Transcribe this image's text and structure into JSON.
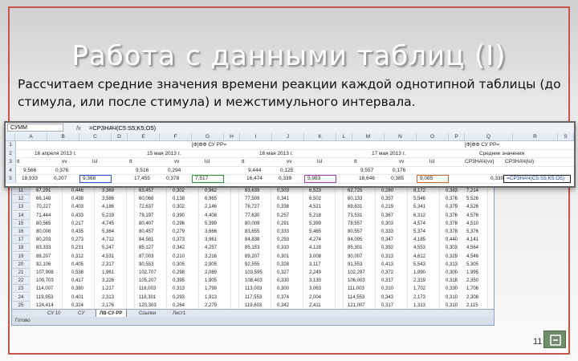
{
  "slide": {
    "title": "Работа с данными таблиц (I)",
    "paragraph": "Рассчитаем средние значения времени реакции каждой однотипной таблицы (до стимула, или после стимула) и межстимульного интервала.",
    "page_number": "11"
  },
  "formula_bar": {
    "name_box": "СУММ",
    "fx": "fx",
    "formula": "=СРЗНАЧ(C5:S5;K5;O5)"
  },
  "overlay": {
    "columns": [
      "A",
      "B",
      "C",
      "D",
      "E",
      "F",
      "G",
      "H",
      "I",
      "J",
      "K",
      "L",
      "M",
      "N",
      "O",
      "P",
      "Q",
      "R",
      "S"
    ],
    "row1": {
      "num": "1",
      "left": "[Ф]ФФ СУ РР=",
      "right": "[Ф]ФФ СУ РР="
    },
    "row2": {
      "num": "2",
      "dates": [
        "16 апреля 2013 г.",
        "15 мая 2013 г.",
        "16 мая 2013 г.",
        "17 мая 2013 г."
      ],
      "avg_title": "Средние значения"
    },
    "row3": {
      "num": "3",
      "labels": [
        "tt",
        "vv",
        "lsl",
        "tt",
        "vv",
        "lsl",
        "tt",
        "vv",
        "lsl",
        "tt",
        "vv",
        "lsl"
      ],
      "avg_label": "СРЗНАЧ(vv)",
      "avg_label2": "СРЗНАЧ(lsl)"
    },
    "row4": {
      "num": "4",
      "values": [
        "9,566",
        "0,376",
        "9,516",
        "0,294",
        "9,444",
        "0,125",
        "9,557",
        "0,176"
      ]
    },
    "row5": {
      "num": "5",
      "values": [
        "18,933",
        "0,207",
        "9,368",
        "17,455",
        "0,378",
        "7,517",
        "16,474",
        "0,339",
        "5,983",
        "18,646",
        "0,385",
        "9,085",
        "0,330"
      ],
      "formula_echo": "=СРЗНАЧ(C5:S5;K5:O5)"
    }
  },
  "sheet": {
    "rows": [
      {
        "n": "11",
        "v": [
          "67,291",
          "0,446",
          "3,369",
          "63,457",
          "0,302",
          "0,962",
          "83,639",
          "0,303",
          "6,523",
          "62,725",
          "0,280",
          "8,172",
          "0,383",
          "7,214"
        ]
      },
      {
        "n": "12",
        "v": [
          "66,148",
          "0,438",
          "3,586",
          "60,068",
          "0,138",
          "6,965",
          "77,509",
          "0,341",
          "6,502",
          "60,133",
          "0,357",
          "5,546",
          "0,376",
          "5,526"
        ]
      },
      {
        "n": "13",
        "v": [
          "70,227",
          "0,403",
          "4,186",
          "72,637",
          "0,302",
          "2,146",
          "76,727",
          "0,338",
          "4,521",
          "69,631",
          "0,219",
          "5,341",
          "0,379",
          "4,526"
        ]
      },
      {
        "n": "14",
        "v": [
          "71,444",
          "0,433",
          "5,219",
          "79,197",
          "0,390",
          "4,408",
          "77,630",
          "0,257",
          "5,218",
          "73,531",
          "0,367",
          "6,312",
          "0,376",
          "4,576"
        ]
      },
      {
        "n": "15",
        "v": [
          "80,565",
          "0,217",
          "4,745",
          "80,407",
          "0,296",
          "5,399",
          "80,009",
          "0,291",
          "5,399",
          "78,557",
          "0,303",
          "4,574",
          "0,378",
          "4,510"
        ]
      },
      {
        "n": "16",
        "v": [
          "80,008",
          "0,435",
          "5,364",
          "80,457",
          "0,279",
          "3,666",
          "83,655",
          "0,333",
          "5,465",
          "80,557",
          "0,333",
          "5,374",
          "0,378",
          "5,376"
        ]
      },
      {
        "n": "17",
        "v": [
          "80,203",
          "0,273",
          "4,712",
          "84,581",
          "0,373",
          "3,961",
          "84,838",
          "0,293",
          "4,274",
          "84,005",
          "0,347",
          "4,185",
          "0,440",
          "4,141"
        ]
      },
      {
        "n": "18",
        "v": [
          "83,333",
          "0,231",
          "5,247",
          "85,127",
          "0,342",
          "4,257",
          "85,153",
          "0,310",
          "4,128",
          "85,301",
          "0,392",
          "4,553",
          "0,303",
          "4,564"
        ]
      },
      {
        "n": "19",
        "v": [
          "88,207",
          "0,312",
          "4,531",
          "87,003",
          "0,210",
          "3,216",
          "89,207",
          "0,301",
          "3,008",
          "90,007",
          "0,313",
          "4,612",
          "0,329",
          "4,546"
        ]
      },
      {
        "n": "20",
        "v": [
          "92,106",
          "0,405",
          "2,317",
          "90,553",
          "0,305",
          "2,905",
          "92,555",
          "0,328",
          "3,117",
          "91,553",
          "0,413",
          "5,543",
          "0,313",
          "5,305"
        ]
      },
      {
        "n": "21",
        "v": [
          "107,908",
          "0,538",
          "1,961",
          "102,707",
          "0,298",
          "2,089",
          "103,595",
          "0,327",
          "2,249",
          "102,297",
          "0,372",
          "1,990",
          "0,300",
          "1,995"
        ]
      },
      {
        "n": "22",
        "v": [
          "100,703",
          "0,417",
          "3,226",
          "105,207",
          "0,395",
          "1,905",
          "108,403",
          "0,330",
          "3,130",
          "106,003",
          "0,317",
          "2,319",
          "0,318",
          "2,350"
        ]
      },
      {
        "n": "23",
        "v": [
          "114,007",
          "0,380",
          "1,217",
          "116,003",
          "0,313",
          "1,799",
          "113,003",
          "0,300",
          "3,063",
          "111,003",
          "0,310",
          "1,702",
          "0,330",
          "1,706"
        ]
      },
      {
        "n": "24",
        "v": [
          "119,953",
          "0,401",
          "2,313",
          "118,301",
          "0,293",
          "1,913",
          "117,553",
          "0,374",
          "2,004",
          "114,553",
          "0,343",
          "2,173",
          "0,310",
          "2,308"
        ]
      },
      {
        "n": "25",
        "v": [
          "124,414",
          "0,324",
          "2,176",
          "120,303",
          "0,264",
          "2,279",
          "119,603",
          "0,342",
          "2,411",
          "121,007",
          "0,317",
          "1,313",
          "0,310",
          "2,115"
        ]
      }
    ],
    "tabs": [
      "CУ 10",
      "CУ",
      "ЛВ-СУ-РР",
      "Ссылки",
      "Лист1"
    ],
    "active_tab": "ЛВ-СУ-РР",
    "status": "Готово"
  },
  "colors": {
    "frame": "#c9544a",
    "blue_box": "#2a4fd0",
    "green_box": "#2a9a3a",
    "purple_box": "#b03ac0",
    "orange_box": "#d06a20"
  }
}
